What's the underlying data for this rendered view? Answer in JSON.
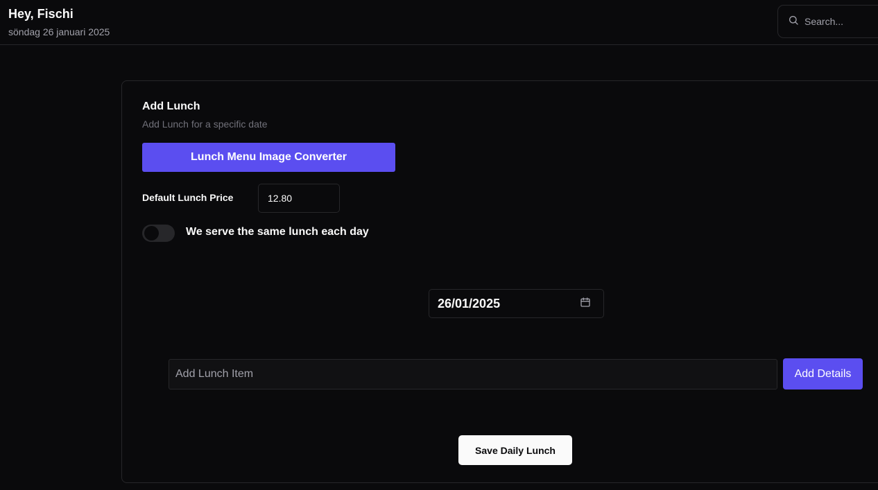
{
  "header": {
    "greeting": "Hey, Fischi",
    "date": "söndag 26 januari 2025",
    "search": {
      "placeholder": "Search...",
      "icon": "search-icon"
    }
  },
  "card": {
    "title": "Add Lunch",
    "description": "Add Lunch for a specific date",
    "converter_button_label": "Lunch Menu Image Converter",
    "price_label": "Default Lunch Price",
    "price_value": "12.80",
    "same_lunch_toggle": {
      "label": "We serve the same lunch each day",
      "on": false
    },
    "date_value": "26/01/2025",
    "date_icon": "calendar-icon",
    "item_input_placeholder": "Add Lunch Item",
    "add_details_label": "Add Details",
    "save_button_label": "Save Daily Lunch"
  },
  "colors": {
    "background": "#0a0a0c",
    "accent": "#5b4ef0",
    "border": "#27272a",
    "muted_text": "#a1a1aa"
  }
}
